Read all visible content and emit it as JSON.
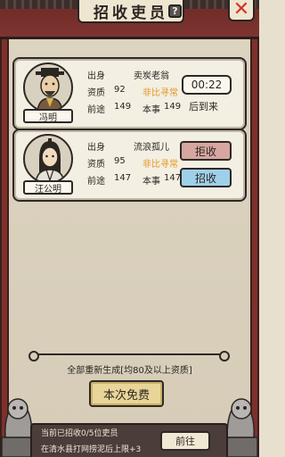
{
  "header": {
    "title": "招收吏员",
    "help_icon": "?",
    "close_icon": "✕"
  },
  "candidates": [
    {
      "name": "冯明",
      "origin_label": "出身",
      "origin": "卖炭老翁",
      "aptitude_label": "资质",
      "aptitude": "92",
      "aptitude_tag": "非比寻常",
      "prospect_label": "前途",
      "prospect": "149",
      "skill_label": "本事",
      "skill": "149",
      "timer": "00:22",
      "status": "后到来"
    },
    {
      "name": "汪公明",
      "origin_label": "出身",
      "origin": "流浪孤儿",
      "aptitude_label": "资质",
      "aptitude": "95",
      "aptitude_tag": "非比寻常",
      "prospect_label": "前途",
      "prospect": "147",
      "skill_label": "本事",
      "skill": "147",
      "reject_label": "拒收",
      "accept_label": "招收"
    }
  ],
  "footer": {
    "regen_text": "全部重新生成[均80及以上资质]",
    "free_button": "本次免费",
    "status_recruited": "当前已招收0/5位吏员",
    "status_hint": "在清水县打网捞泥后上限+3",
    "go_button": "前往"
  },
  "colors": {
    "accent_orange": "#e5951d",
    "reject_bg": "#d7a6a0",
    "accept_bg": "#9fd0ea",
    "close_red": "#d33427"
  }
}
